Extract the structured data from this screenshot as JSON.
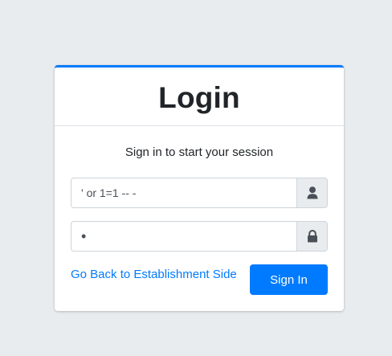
{
  "login": {
    "title": "Login",
    "subtitle": "Sign in to start your session",
    "username": {
      "value": "' or 1=1 -- -",
      "icon": "user-icon"
    },
    "password": {
      "value": "•",
      "icon": "lock-icon"
    },
    "back_link_label": "Go Back to Establishment Side",
    "signin_label": "Sign In"
  },
  "colors": {
    "background": "#e9ecef",
    "accent": "#007bff",
    "card": "#ffffff",
    "addon": "#e9ecef"
  }
}
